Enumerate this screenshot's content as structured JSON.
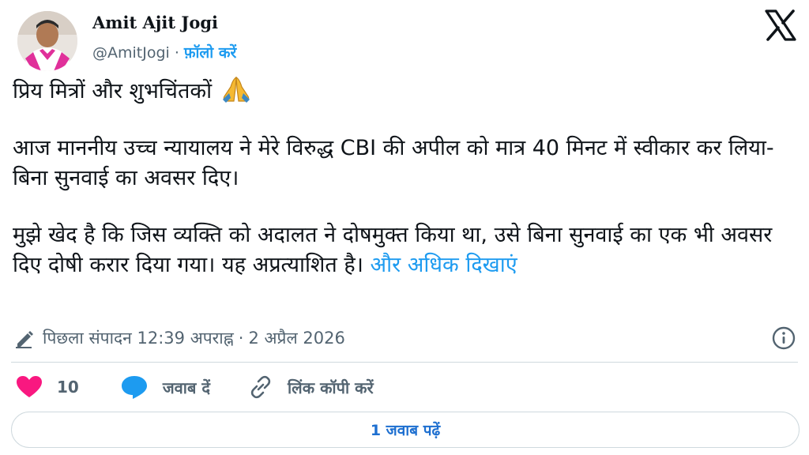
{
  "author": {
    "name": "Amit Ajit Jogi",
    "handle": "@AmitJogi",
    "separator": "·",
    "follow_label": "फ़ॉलो करें"
  },
  "tweet": {
    "paragraph1": "प्रिय मित्रों और शुभचिंतकों",
    "paragraph2": "आज माननीय उच्च न्यायालय ने मेरे विरुद्ध CBI की अपील को मात्र 40 मिनट में स्वीकार कर लिया- बिना सुनवाई का अवसर दिए।",
    "paragraph3": "मुझे खेद है कि जिस व्यक्ति को अदालत ने दोषमुक्त किया था, उसे बिना सुनवाई का एक भी अवसर दिए दोषी करार दिया गया। यह अप्रत्याशित है।",
    "show_more_label": "और अधिक दिखाएं"
  },
  "meta": {
    "edited_label": "पिछला संपादन",
    "time": "12:39 अपराह्न",
    "separator": "·",
    "date": "2 अप्रैल 2026"
  },
  "actions": {
    "like_count": "10",
    "reply_label": "जवाब दें",
    "copy_link_label": "लिंक कॉपी करें"
  },
  "read_replies_label": "1 जवाब पढ़ें",
  "colors": {
    "accent": "#1d9bf0",
    "like": "#f91880",
    "reply": "#1d9bf0",
    "text": "#0f1419",
    "muted": "#536471",
    "avatar_scarf": "#e0309a"
  },
  "icons": {
    "close": "x-logo-icon",
    "emoji": "folded-hands-icon",
    "edit": "pencil-icon",
    "info": "info-icon",
    "like": "heart-icon",
    "reply": "speech-bubble-icon",
    "copy": "link-icon"
  }
}
